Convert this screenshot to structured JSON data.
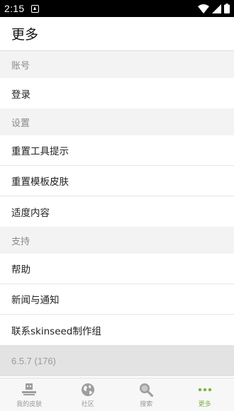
{
  "status_bar": {
    "time": "2:15"
  },
  "app_bar": {
    "title": "更多"
  },
  "sections": [
    {
      "header": "账号",
      "items": [
        "登录"
      ]
    },
    {
      "header": "设置",
      "items": [
        "重置工具提示",
        "重置模板皮肤",
        "适度内容"
      ]
    },
    {
      "header": "支持",
      "items": [
        "帮助",
        "新闻与通知",
        "联系skinseed制作组"
      ]
    }
  ],
  "version": "6.5.7 (176)",
  "bottom_nav": [
    {
      "label": "我的皮肤",
      "icon": "skins-icon",
      "active": false
    },
    {
      "label": "社区",
      "icon": "globe-icon",
      "active": false
    },
    {
      "label": "搜索",
      "icon": "search-icon",
      "active": false
    },
    {
      "label": "更多",
      "icon": "more-dots-icon",
      "active": true
    }
  ],
  "colors": {
    "accent": "#7cb342",
    "inactive": "#999999"
  }
}
